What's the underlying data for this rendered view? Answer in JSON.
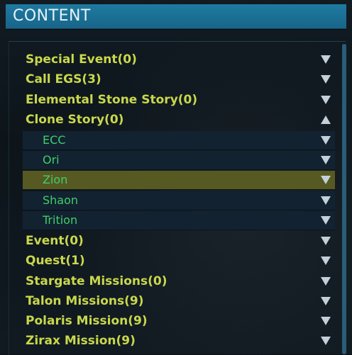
{
  "header": {
    "title": "CONTENT"
  },
  "categories": [
    {
      "label": "Special Event(0)"
    },
    {
      "label": "Call EGS(3)"
    },
    {
      "label": "Elemental Stone Story(0)"
    },
    {
      "label": "Clone Story(0)",
      "expanded": true,
      "children": [
        {
          "label": "ECC"
        },
        {
          "label": "Ori"
        },
        {
          "label": "Zion",
          "selected": true
        },
        {
          "label": "Shaon"
        },
        {
          "label": "Trition"
        }
      ]
    },
    {
      "label": "Event(0)"
    },
    {
      "label": "Quest(1)"
    },
    {
      "label": "Stargate Missions(0)"
    },
    {
      "label": "Talon Missions(9)"
    },
    {
      "label": "Polaris Mission(9)"
    },
    {
      "label": "Zirax Mission(9)"
    }
  ],
  "colors": {
    "category_text": "#c9d84c",
    "subitem_text": "#3fcf6a",
    "selected_bg": "#565a22",
    "header_bg": "#1e7aa0"
  },
  "icons": {
    "collapsed": "triangle-down-icon",
    "expanded": "triangle-up-icon"
  }
}
